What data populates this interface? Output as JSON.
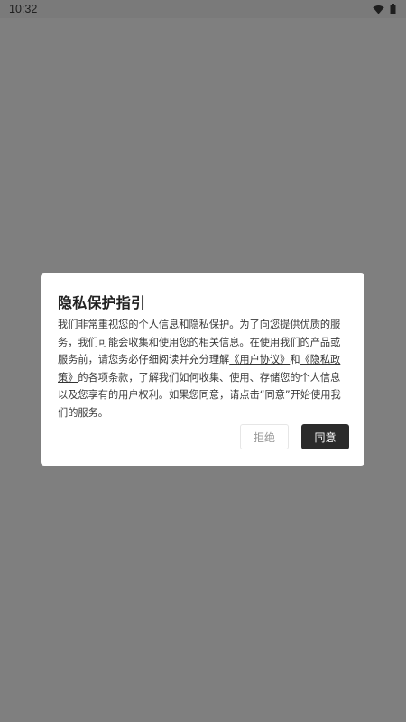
{
  "status_bar": {
    "time": "10:32",
    "icons": [
      "wifi-icon",
      "battery-icon"
    ]
  },
  "dialog": {
    "title": "隐私保护指引",
    "body": {
      "text_1": "我们非常重视您的个人信息和隐私保护。为了向您提供优质的服务，我们可能会收集和使用您的相关信息。在使用我们的产品或服务前，请您务必仔细阅读并充分理解",
      "link_user_agreement": "《用户协议》",
      "text_2": "和",
      "link_privacy_policy": "《隐私政策》",
      "text_3": "的各项条款，了解我们如何收集、使用、存储您的个人信息以及您享有的用户权利。如果您同意，请点击“同意”开始使用我们的服务。"
    },
    "buttons": {
      "decline": "拒绝",
      "agree": "同意"
    }
  },
  "colors": {
    "overlay": "#7f7f7f",
    "dialog_bg": "#ffffff",
    "agree_bg": "#2b2b2b",
    "decline_text": "#999999"
  }
}
